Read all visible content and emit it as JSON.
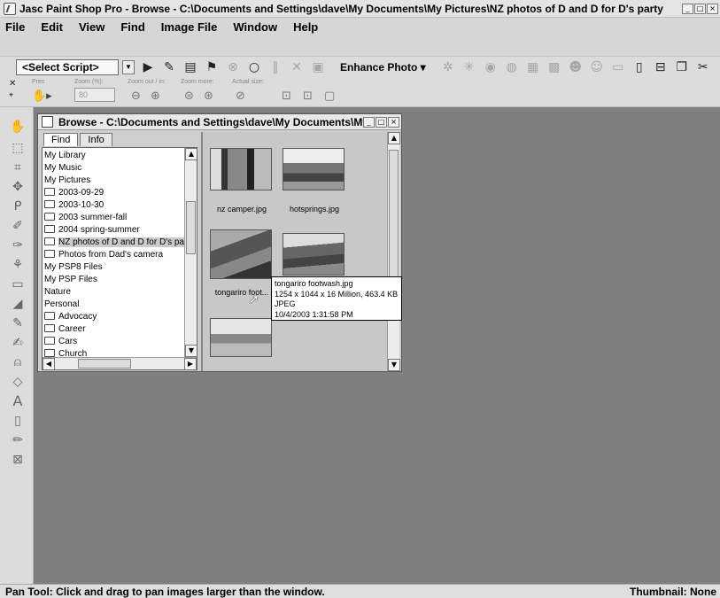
{
  "window": {
    "title": "Jasc Paint Shop Pro - Browse - C:\\Documents and Settings\\dave\\My Documents\\My Pictures\\NZ photos of D and D for D's party",
    "controls": [
      "_",
      "□",
      "×"
    ]
  },
  "menu": [
    "File",
    "Edit",
    "View",
    "Find",
    "Image File",
    "Window",
    "Help"
  ],
  "toolbar": {
    "script_select": "<Select Script>",
    "enhance_label": "Enhance Photo",
    "icons": [
      "play-icon",
      "script-edit-icon",
      "script-run-icon",
      "record-icon",
      "stop-icon",
      "circle-icon",
      "pause-icon",
      "cancel-icon",
      "save-icon",
      "new-file-icon",
      "open-file-icon",
      "copy-icon",
      "scissors-icon"
    ]
  },
  "tool_options": {
    "preset_label": "Pres",
    "zoom_label": "Zoom (%):",
    "zoom_value": "80",
    "zoom_out_label": "Zoom out / in:",
    "zoom_more_label": "Zoom more:",
    "actual_size_label": "Actual size:"
  },
  "tools": [
    "pan-icon",
    "select-icon",
    "crop-icon",
    "move-icon",
    "lasso-icon",
    "dropper-icon",
    "paint-icon",
    "clone-icon",
    "shape-icon",
    "eraser-icon",
    "paintbrush-icon",
    "fill-icon",
    "airbrush-icon",
    "pen-icon",
    "text-icon",
    "rectangle-icon",
    "pencil-icon",
    "frame-icon"
  ],
  "browse": {
    "title": "Browse - C:\\Documents and Settings\\dave\\My Documents\\My...",
    "tabs": [
      "Find",
      "Info"
    ],
    "tree": [
      {
        "label": "My Library",
        "folder": false
      },
      {
        "label": "My Music",
        "folder": false
      },
      {
        "label": "My Pictures",
        "folder": false
      },
      {
        "label": "2003-09-29",
        "folder": true
      },
      {
        "label": "2003-10-30",
        "folder": true
      },
      {
        "label": "2003 summer-fall",
        "folder": true
      },
      {
        "label": "2004 spring-summer",
        "folder": true
      },
      {
        "label": "NZ photos of D and D for D's part",
        "folder": true,
        "selected": true
      },
      {
        "label": "Photos from Dad's camera",
        "folder": true
      },
      {
        "label": "My PSP8 Files",
        "folder": false
      },
      {
        "label": "My PSP Files",
        "folder": false
      },
      {
        "label": "Nature",
        "folder": false
      },
      {
        "label": "Personal",
        "folder": false
      },
      {
        "label": "Advocacy",
        "folder": true
      },
      {
        "label": "Career",
        "folder": true
      },
      {
        "label": "Cars",
        "folder": true
      },
      {
        "label": "Church",
        "folder": true
      }
    ],
    "thumbnails": [
      {
        "caption": "nz camper.jpg"
      },
      {
        "caption": "hotsprings.jpg"
      },
      {
        "caption": "tongariro foot..."
      },
      {
        "caption": ""
      },
      {
        "caption": ""
      }
    ],
    "tooltip": {
      "lines": [
        "tongariro footwash.jpg",
        "1254 x 1044 x 16 Million, 463.4 KB",
        "JPEG",
        "10/4/2003 1:31:58 PM"
      ]
    }
  },
  "status": {
    "left": "Pan Tool: Click and drag to pan images larger than the window.",
    "right": "Thumbnail: None"
  }
}
